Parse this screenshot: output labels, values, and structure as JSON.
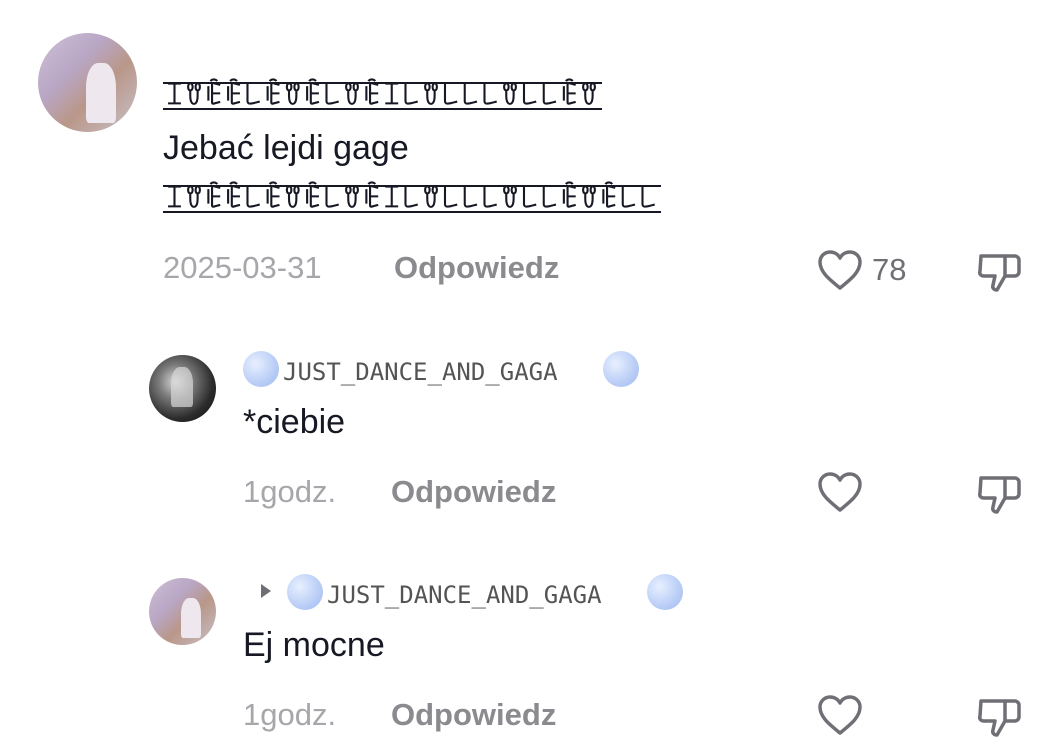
{
  "comment": {
    "deco_top": "ꀤꀎꍟꍟ꒒ꍟꀎꍟ꒒ꀎꍟꀤ꒒ꀎ꒒꒒꒒ꀎ꒒꒒ꍟꀎ",
    "text": "Jebać lejdi gage",
    "deco_bottom": "ꀤꀎꍟꍟ꒒ꍟꀎꍟ꒒ꀎꍟꀤ꒒ꀎ꒒꒒꒒ꀎ꒒꒒ꍟꀎꍟ꒒꒒",
    "date": "2025-03-31",
    "reply_label": "Odpowiedz",
    "likes": "78"
  },
  "replies": [
    {
      "username": "JUST_DANCE_AND_GAGA",
      "text": "*ciebie",
      "time": "1godz.",
      "reply_label": "Odpowiedz"
    },
    {
      "username": "JUST_DANCE_AND_GAGA",
      "text": "Ej mocne",
      "time": "1godz.",
      "reply_label": "Odpowiedz"
    }
  ],
  "icons": {
    "like": "heart-outline-icon",
    "dislike": "thumbs-down-icon",
    "reply_to": "caret-right-icon"
  }
}
